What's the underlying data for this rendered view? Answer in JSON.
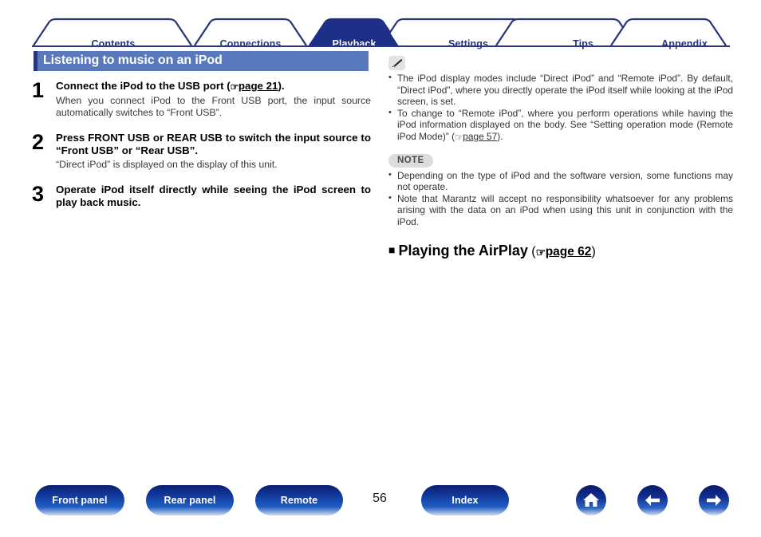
{
  "tabs": [
    {
      "label": "Contents",
      "active": false
    },
    {
      "label": "Connections",
      "active": false
    },
    {
      "label": "Playback",
      "active": true
    },
    {
      "label": "Settings",
      "active": false
    },
    {
      "label": "Tips",
      "active": false
    },
    {
      "label": "Appendix",
      "active": false
    }
  ],
  "section": {
    "title": "Listening to music on an iPod"
  },
  "steps": [
    {
      "number": "1",
      "heading_pre": "Connect the iPod to the USB port (",
      "heading_ref": "page 21",
      "heading_post": ").",
      "body": "When you connect iPod to the Front USB port, the input source automatically switches to “Front USB”."
    },
    {
      "number": "2",
      "heading_pre": "Press FRONT USB or REAR USB to switch the input source to “Front USB” or “Rear USB”.",
      "heading_ref": "",
      "heading_post": "",
      "body": "“Direct iPod” is displayed on the display of this unit."
    },
    {
      "number": "3",
      "heading_pre": "Operate iPod itself directly while seeing the iPod screen to play back music.",
      "heading_ref": "",
      "heading_post": "",
      "body": ""
    }
  ],
  "tip_block": {
    "icon": "pencil-icon",
    "bullets": [
      "The iPod display modes include “Direct iPod” and “Remote iPod”. By default, “Direct iPod”, where you directly operate the iPod itself while looking at the iPod screen, is set.",
      "To change to “Remote iPod”, where you perform operations while having the iPod information displayed on the body. See “Setting operation mode (Remote iPod Mode)” ("
    ],
    "bullet2_ref": "page 57",
    "bullet2_post": ")."
  },
  "note_block": {
    "badge": "NOTE",
    "bullets": [
      "Depending on the type of iPod and the software version, some functions may not operate.",
      "Note that Marantz will accept no responsibility whatsoever for any problems arising with the data on an iPod when using this unit in conjunction with the iPod."
    ]
  },
  "airplay": {
    "square": "■",
    "title": "Playing the AirPlay",
    "ref": "page 62"
  },
  "footer": {
    "buttons": [
      {
        "label": "Front panel"
      },
      {
        "label": "Rear panel"
      },
      {
        "label": "Remote"
      },
      {
        "label": "Index"
      }
    ],
    "page_number": "56",
    "icons": [
      {
        "name": "home-icon"
      },
      {
        "name": "arrow-left-icon"
      },
      {
        "name": "arrow-right-icon"
      }
    ]
  },
  "colors": {
    "tab_border": "#27357e",
    "tab_active_fill": "#1d2f86",
    "title_bar": "#5a79bd",
    "title_edge": "#27357e",
    "button_blue": "#123a9e"
  }
}
